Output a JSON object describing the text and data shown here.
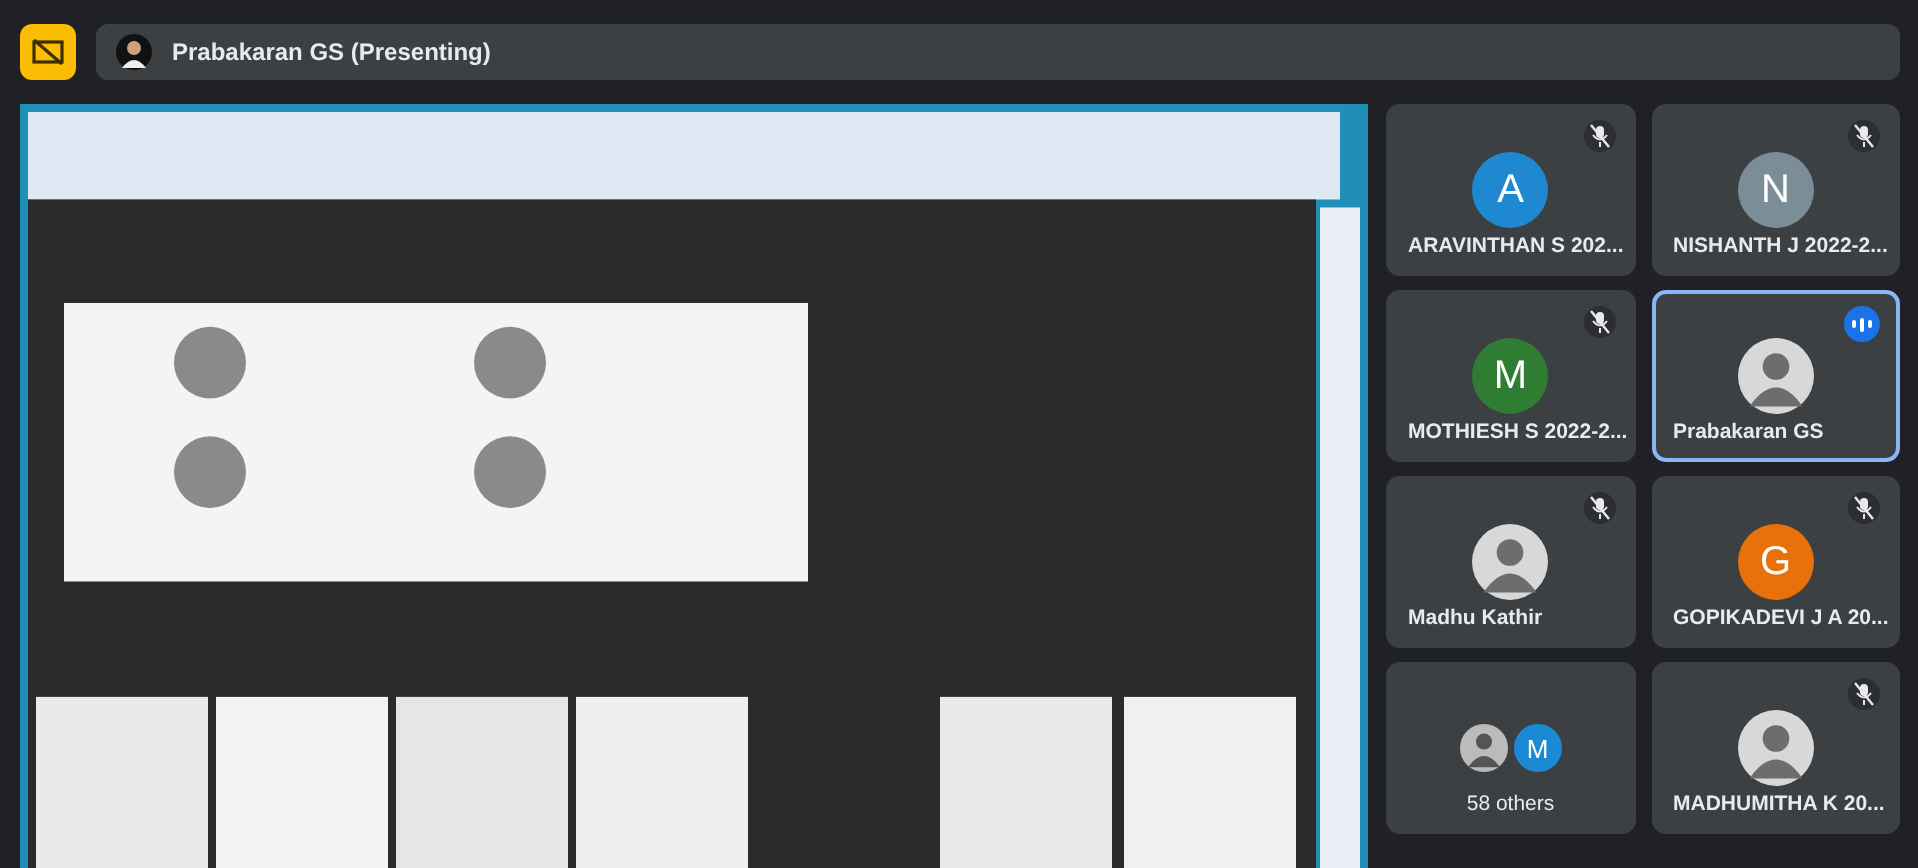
{
  "presenter_bar": {
    "label": "Prabakaran GS (Presenting)"
  },
  "tiles": [
    {
      "kind": "letter",
      "name": "ARAVINTHAN S 202...",
      "initial": "A",
      "color": "#1e88d0",
      "muted": true,
      "speaking": false
    },
    {
      "kind": "letter",
      "name": "NISHANTH J 2022-2...",
      "initial": "N",
      "color": "#7b8e98",
      "muted": true,
      "speaking": false
    },
    {
      "kind": "letter",
      "name": "MOTHIESH S 2022-2...",
      "initial": "M",
      "color": "#2e7d32",
      "muted": true,
      "speaking": false
    },
    {
      "name": "Prabakaran GS",
      "muted": false,
      "speaking": true
    },
    {
      "name": "Madhu Kathir",
      "muted": true,
      "speaking": false
    },
    {
      "kind": "letter",
      "name": "GOPIKADEVI J A 20...",
      "initial": "G",
      "color": "#e8710a",
      "muted": true,
      "speaking": false
    },
    {
      "kind": "others",
      "name": "58 others",
      "initial": "M",
      "color": "#1a8ad4",
      "muted": false,
      "speaking": false
    },
    {
      "name": "MADHUMITHA K 20...",
      "muted": true,
      "speaking": false
    }
  ]
}
